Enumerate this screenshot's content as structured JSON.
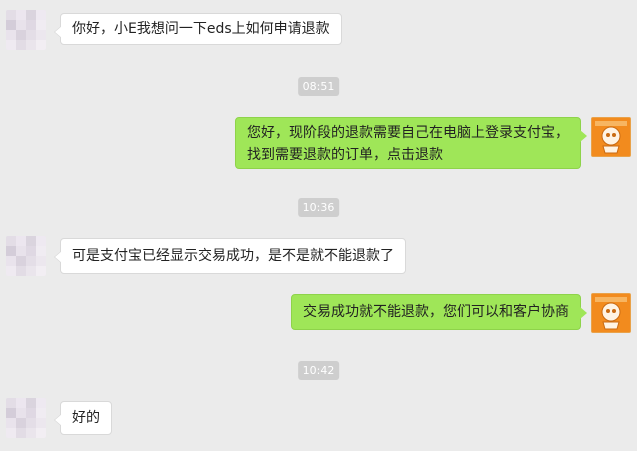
{
  "colors": {
    "background": "#ebebeb",
    "incoming_bubble": "#ffffff",
    "outgoing_bubble": "#9fe658",
    "timestamp_bg": "#cecece",
    "agent_avatar": "#f28b1e"
  },
  "messages": [
    {
      "sender": "customer",
      "avatar": "pixelated-avatar",
      "text": "你好，小E我想问一下eds上如何申请退款"
    },
    {
      "timestamp": "08:51"
    },
    {
      "sender": "agent",
      "avatar": "robot-avatar",
      "lines": [
        "您好，现阶段的退款需要自己在电脑上登录支付宝，",
        "找到需要退款的订单，点击退款"
      ]
    },
    {
      "timestamp": "10:36"
    },
    {
      "sender": "customer",
      "avatar": "pixelated-avatar",
      "text": "可是支付宝已经显示交易成功，是不是就不能退款了"
    },
    {
      "sender": "agent",
      "avatar": "robot-avatar",
      "text": "交易成功就不能退款，您们可以和客户协商"
    },
    {
      "timestamp": "10:42"
    },
    {
      "sender": "customer",
      "avatar": "pixelated-avatar",
      "text": "好的"
    }
  ]
}
